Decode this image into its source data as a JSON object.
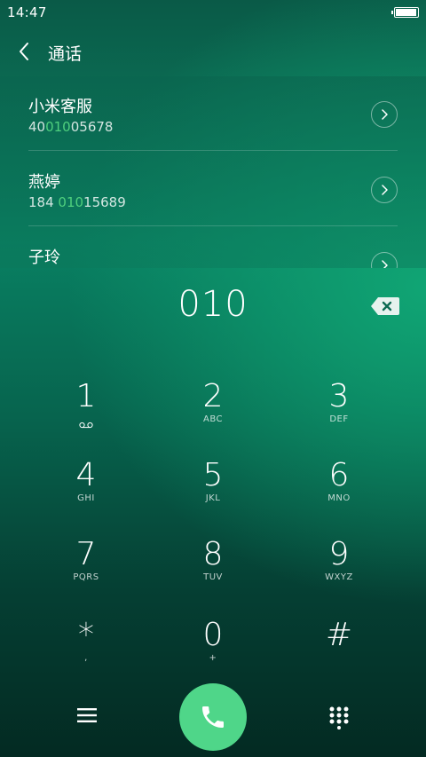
{
  "status_bar": {
    "time": "14:47",
    "battery": 1.0
  },
  "header": {
    "title": "通话",
    "back_icon": "back-chevron-icon"
  },
  "contacts": [
    {
      "name": "小米客服",
      "number_pre": "40",
      "number_match": "010",
      "number_post": "05678"
    },
    {
      "name": "燕婷",
      "number_pre": "184 ",
      "number_match": "010",
      "number_post": "15689"
    },
    {
      "name": "子玲",
      "number_pre": "",
      "number_match": "",
      "number_post": ""
    }
  ],
  "dialer": {
    "input": "010",
    "backspace_icon": "backspace-icon"
  },
  "keypad": [
    {
      "digit": "1",
      "letters": "",
      "icon": "voicemail-icon"
    },
    {
      "digit": "2",
      "letters": "ABC"
    },
    {
      "digit": "3",
      "letters": "DEF"
    },
    {
      "digit": "4",
      "letters": "GHI"
    },
    {
      "digit": "5",
      "letters": "JKL"
    },
    {
      "digit": "6",
      "letters": "MNO"
    },
    {
      "digit": "7",
      "letters": "PQRS"
    },
    {
      "digit": "8",
      "letters": "TUV"
    },
    {
      "digit": "9",
      "letters": "WXYZ"
    },
    {
      "digit": "*",
      "letters": ","
    },
    {
      "digit": "0",
      "letters": "+"
    },
    {
      "digit": "#",
      "letters": ""
    }
  ],
  "bottom_bar": {
    "menu_icon": "menu-icon",
    "call_icon": "phone-icon",
    "keypad_icon": "dialpad-icon"
  },
  "colors": {
    "accent": "#4fd689",
    "match_highlight": "#4fd07e",
    "background_top": "#0a5a47",
    "background_bottom": "#032a22"
  }
}
